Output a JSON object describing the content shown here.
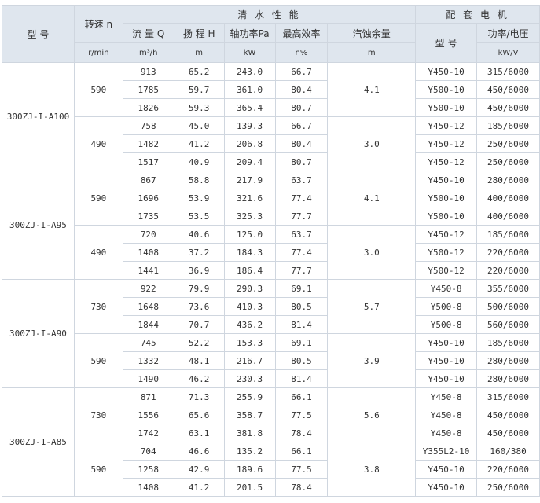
{
  "header": {
    "model": "型  号",
    "speed": "转速 n",
    "speed_unit": "r/min",
    "clear_water": "清 水 性 能",
    "motor": "配 套 电 机",
    "flow": "流 量 Q",
    "flow_unit": "m³/h",
    "head": "扬 程 H",
    "head_unit": "m",
    "shaft_power": "轴功率Pa",
    "shaft_power_unit": "kW",
    "max_eff": "最高效率",
    "max_eff_unit": "η%",
    "npsh": "汽蚀余量",
    "npsh_unit": "m",
    "motor_model": "型 号",
    "power_voltage": "功率/电压",
    "power_voltage_unit": "kW/V"
  },
  "groups": [
    {
      "model": "300ZJ-I-A100",
      "speeds": [
        {
          "speed": "590",
          "npsh": "4.1",
          "rows": [
            {
              "q": "913",
              "h": "65.2",
              "p": "243.0",
              "eff": "66.7",
              "motor": "Y450-10",
              "pv": "315/6000"
            },
            {
              "q": "1785",
              "h": "59.7",
              "p": "361.0",
              "eff": "80.4",
              "motor": "Y500-10",
              "pv": "450/6000"
            },
            {
              "q": "1826",
              "h": "59.3",
              "p": "365.4",
              "eff": "80.7",
              "motor": "Y500-10",
              "pv": "450/6000"
            }
          ]
        },
        {
          "speed": "490",
          "npsh": "3.0",
          "rows": [
            {
              "q": "758",
              "h": "45.0",
              "p": "139.3",
              "eff": "66.7",
              "motor": "Y450-12",
              "pv": "185/6000"
            },
            {
              "q": "1482",
              "h": "41.2",
              "p": "206.8",
              "eff": "80.4",
              "motor": "Y450-12",
              "pv": "250/6000"
            },
            {
              "q": "1517",
              "h": "40.9",
              "p": "209.4",
              "eff": "80.7",
              "motor": "Y450-12",
              "pv": "250/6000"
            }
          ]
        }
      ]
    },
    {
      "model": "300ZJ-I-A95",
      "speeds": [
        {
          "speed": "590",
          "npsh": "4.1",
          "rows": [
            {
              "q": "867",
              "h": "58.8",
              "p": "217.9",
              "eff": "63.7",
              "motor": "Y450-10",
              "pv": "280/6000"
            },
            {
              "q": "1696",
              "h": "53.9",
              "p": "321.6",
              "eff": "77.4",
              "motor": "Y500-10",
              "pv": "400/6000"
            },
            {
              "q": "1735",
              "h": "53.5",
              "p": "325.3",
              "eff": "77.7",
              "motor": "Y500-10",
              "pv": "400/6000"
            }
          ]
        },
        {
          "speed": "490",
          "npsh": "3.0",
          "rows": [
            {
              "q": "720",
              "h": "40.6",
              "p": "125.0",
              "eff": "63.7",
              "motor": "Y450-12",
              "pv": "185/6000"
            },
            {
              "q": "1408",
              "h": "37.2",
              "p": "184.3",
              "eff": "77.4",
              "motor": "Y500-12",
              "pv": "220/6000"
            },
            {
              "q": "1441",
              "h": "36.9",
              "p": "186.4",
              "eff": "77.7",
              "motor": "Y500-12",
              "pv": "220/6000"
            }
          ]
        }
      ]
    },
    {
      "model": "300ZJ-I-A90",
      "speeds": [
        {
          "speed": "730",
          "npsh": "5.7",
          "rows": [
            {
              "q": "922",
              "h": "79.9",
              "p": "290.3",
              "eff": "69.1",
              "motor": "Y450-8",
              "pv": "355/6000"
            },
            {
              "q": "1648",
              "h": "73.6",
              "p": "410.3",
              "eff": "80.5",
              "motor": "Y500-8",
              "pv": "500/6000"
            },
            {
              "q": "1844",
              "h": "70.7",
              "p": "436.2",
              "eff": "81.4",
              "motor": "Y500-8",
              "pv": "560/6000"
            }
          ]
        },
        {
          "speed": "590",
          "npsh": "3.9",
          "rows": [
            {
              "q": "745",
              "h": "52.2",
              "p": "153.3",
              "eff": "69.1",
              "motor": "Y450-10",
              "pv": "185/6000"
            },
            {
              "q": "1332",
              "h": "48.1",
              "p": "216.7",
              "eff": "80.5",
              "motor": "Y450-10",
              "pv": "280/6000"
            },
            {
              "q": "1490",
              "h": "46.2",
              "p": "230.3",
              "eff": "81.4",
              "motor": "Y450-10",
              "pv": "280/6000"
            }
          ]
        }
      ]
    },
    {
      "model": "300ZJ-1-A85",
      "speeds": [
        {
          "speed": "730",
          "npsh": "5.6",
          "rows": [
            {
              "q": "871",
              "h": "71.3",
              "p": "255.9",
              "eff": "66.1",
              "motor": "Y450-8",
              "pv": "315/6000"
            },
            {
              "q": "1556",
              "h": "65.6",
              "p": "358.7",
              "eff": "77.5",
              "motor": "Y450-8",
              "pv": "450/6000"
            },
            {
              "q": "1742",
              "h": "63.1",
              "p": "381.8",
              "eff": "78.4",
              "motor": "Y450-8",
              "pv": "450/6000"
            }
          ]
        },
        {
          "speed": "590",
          "npsh": "3.8",
          "rows": [
            {
              "q": "704",
              "h": "46.6",
              "p": "135.2",
              "eff": "66.1",
              "motor": "Y355L2-10",
              "pv": "160/380"
            },
            {
              "q": "1258",
              "h": "42.9",
              "p": "189.6",
              "eff": "77.5",
              "motor": "Y450-10",
              "pv": "220/6000"
            },
            {
              "q": "1408",
              "h": "41.2",
              "p": "201.5",
              "eff": "78.4",
              "motor": "Y450-10",
              "pv": "250/6000"
            }
          ]
        }
      ]
    }
  ]
}
